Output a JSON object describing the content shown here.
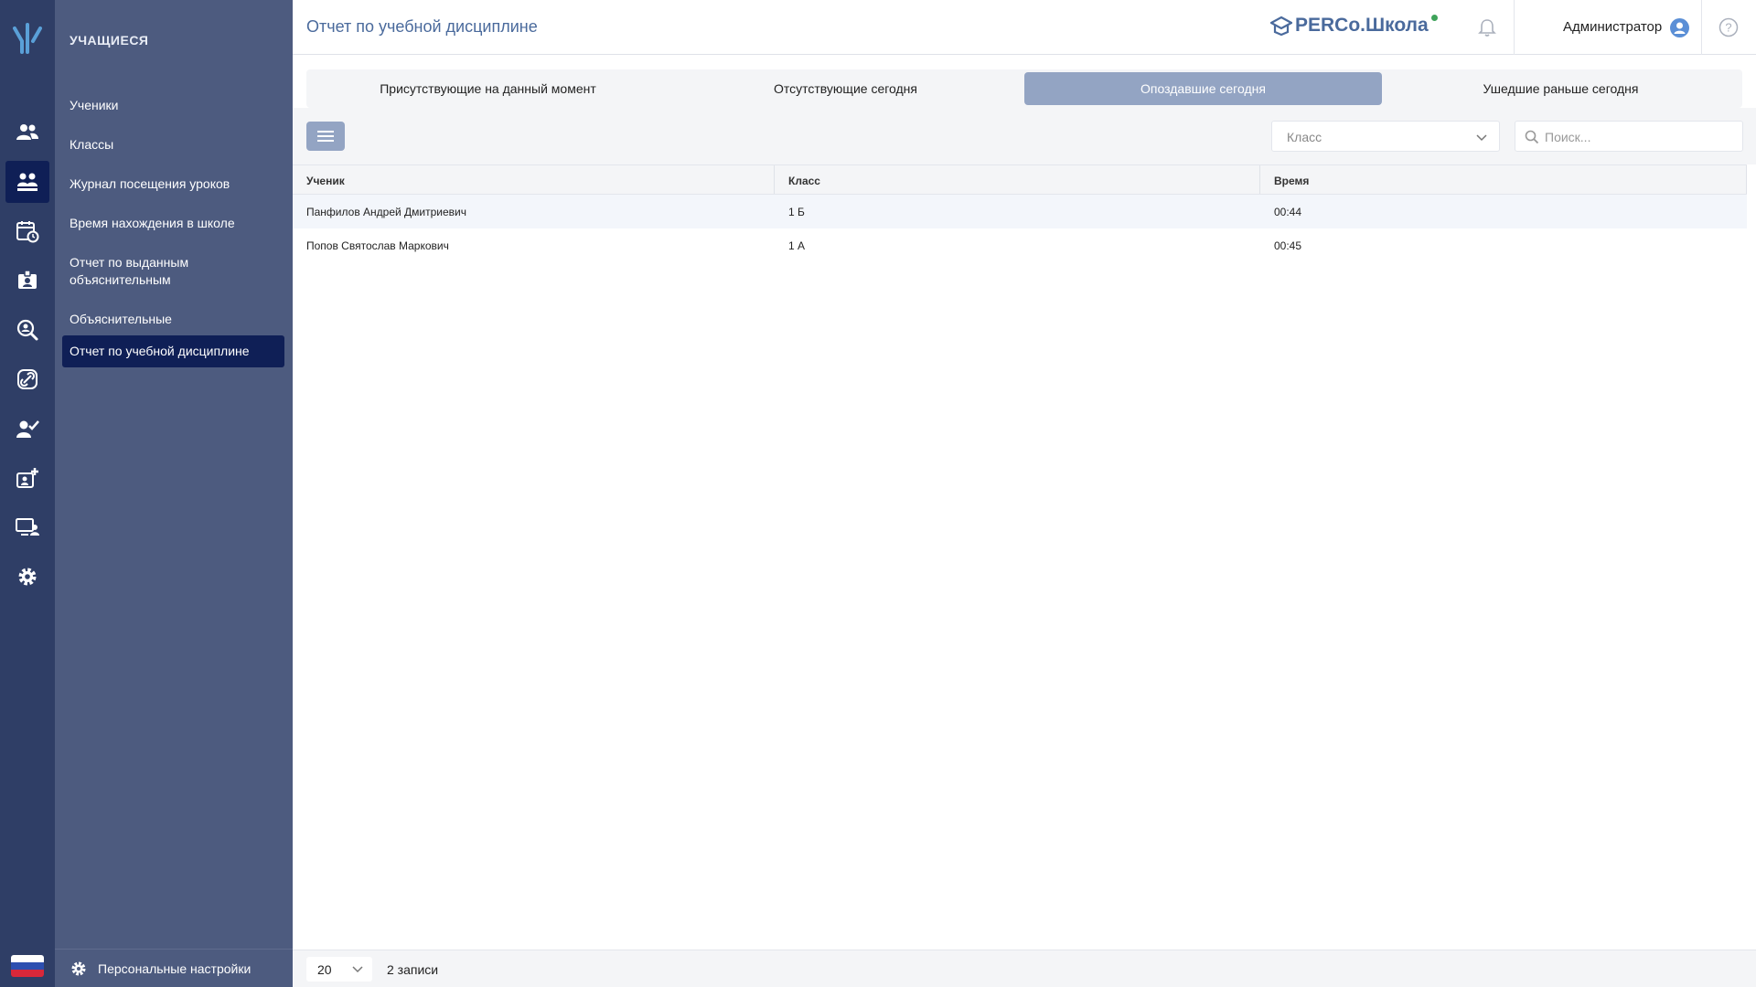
{
  "app": {
    "brand": "PERCo.Школа",
    "page_title": "Отчет по учебной дисциплине",
    "user": "Администратор",
    "help_glyph": "?"
  },
  "rail": {
    "items": [
      {
        "icon": "users-icon"
      },
      {
        "icon": "students-icon",
        "active": true
      },
      {
        "icon": "calendar-clock-icon"
      },
      {
        "icon": "id-badge-icon"
      },
      {
        "icon": "user-search-icon"
      },
      {
        "icon": "link-icon"
      },
      {
        "icon": "user-check-icon"
      },
      {
        "icon": "id-add-icon"
      },
      {
        "icon": "monitor-user-icon"
      },
      {
        "icon": "gear-icon"
      }
    ]
  },
  "submenu": {
    "title": "УЧАЩИЕСЯ",
    "items": [
      {
        "label": "Ученики"
      },
      {
        "label": "Классы"
      },
      {
        "label": "Журнал посещения уроков"
      },
      {
        "label": "Время нахождения в школе"
      },
      {
        "label": "Отчет по выданным объяснительным"
      },
      {
        "label": "Объяснительные"
      },
      {
        "label": "Отчет по учебной дисциплине",
        "active": true
      }
    ],
    "footer": "Персональные настройки"
  },
  "tabs": [
    {
      "label": "Присутствующие на данный момент"
    },
    {
      "label": "Отсутствующие сегодня"
    },
    {
      "label": "Опоздавшие сегодня",
      "active": true
    },
    {
      "label": "Ушедшие раньше сегодня"
    }
  ],
  "filters": {
    "class_placeholder": "Класс",
    "search_placeholder": "Поиск..."
  },
  "table": {
    "columns": [
      "Ученик",
      "Класс",
      "Время"
    ],
    "rows": [
      {
        "student": "Панфилов Андрей Дмитриевич",
        "class": "1 Б",
        "time": "00:44"
      },
      {
        "student": "Попов Святослав Маркович",
        "class": "1 А",
        "time": "00:45"
      }
    ]
  },
  "footer": {
    "page_size": "20",
    "records": "2 записи"
  },
  "colors": {
    "rail": "#2f3e66",
    "submenu": "#4d5b7f",
    "active": "#0f1f56",
    "accent": "#93a4c3",
    "title": "#4a6a9c",
    "status_online": "#3ea35a"
  }
}
